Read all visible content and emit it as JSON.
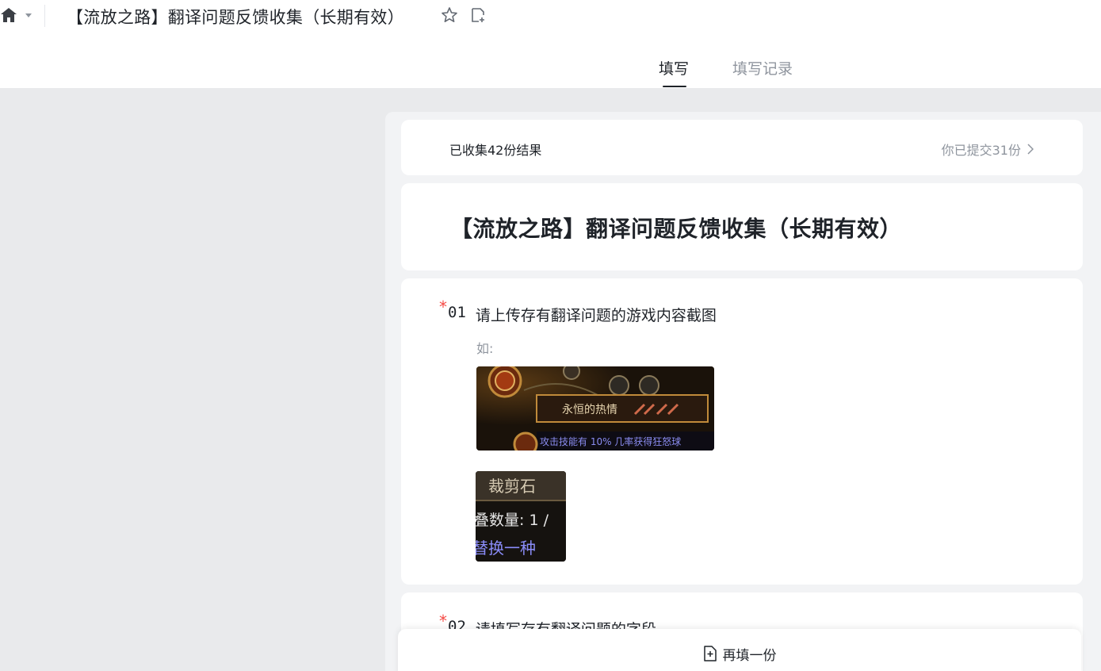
{
  "app": {
    "doc_title": "【流放之路】翻译问题反馈收集（长期有效）"
  },
  "tabs": [
    {
      "label": "填写",
      "active": true
    },
    {
      "label": "填写记录",
      "active": false
    }
  ],
  "stats": {
    "collected": "已收集42份结果",
    "submitted": "你已提交31份"
  },
  "form": {
    "title": "【流放之路】翻译问题反馈收集（长期有效）"
  },
  "questions": [
    {
      "required_mark": "*",
      "number": "01",
      "text": "请上传存有翻译问题的游戏内容截图",
      "hint": "如:",
      "example_images": [
        {
          "icon": "game-screenshot-passive-skill",
          "caption": "永恒的热情",
          "subcaption": "攻击技能有 10% 几率获得狂怒球"
        },
        {
          "icon": "game-screenshot-item-tooltip",
          "caption": "裁剪石",
          "line2": "叠数量: 1 /",
          "line3": "替换一种"
        }
      ]
    },
    {
      "required_mark": "*",
      "number": "02",
      "text": "请填写存有翻译问题的字段"
    }
  ],
  "bottom_bar": {
    "refill_label": "再填一份"
  },
  "colors": {
    "required": "#f54a45",
    "text": "#1f2329",
    "muted": "#8f959e",
    "page_bg": "#e9eaec"
  }
}
